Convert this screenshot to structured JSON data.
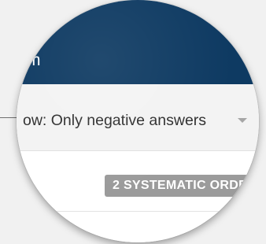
{
  "header": {
    "title_fragment": "m"
  },
  "filter": {
    "label": "ow: Only negative answers",
    "caret_icon": "chevron-down-icon"
  },
  "badge": {
    "label": "2 SYSTEMATIC ORDE"
  },
  "colors": {
    "header_bg": "#0e3a62",
    "filter_bg": "#f3f3f3",
    "badge_bg": "#9b9b9b",
    "page_bg": "#f1f1f1"
  }
}
